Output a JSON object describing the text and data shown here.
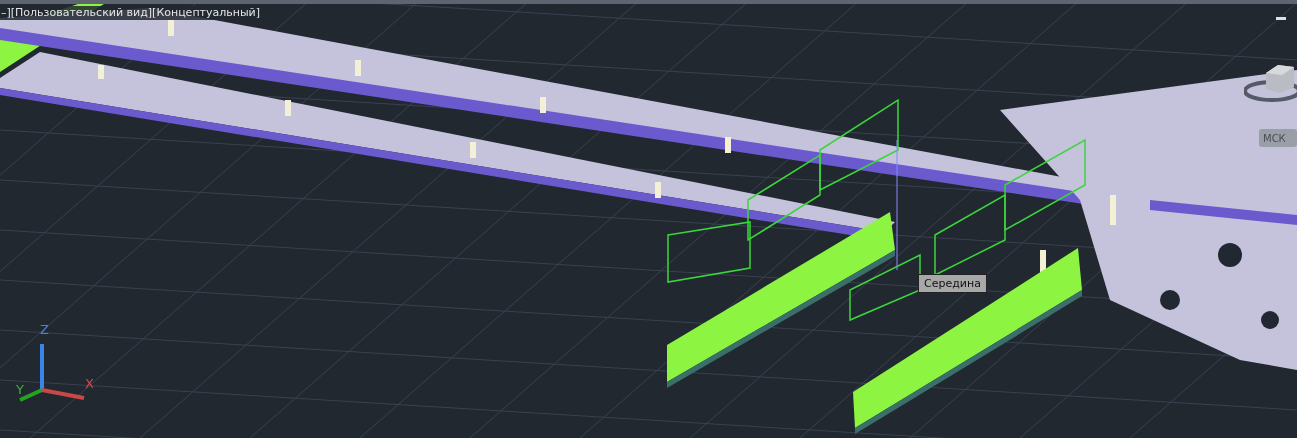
{
  "viewport": {
    "label": "–][Пользовательский вид][Концептуальный]"
  },
  "viewcube": {
    "ucs_button": "МСК"
  },
  "tooltip": {
    "text": "Середина"
  },
  "ucs_icon": {
    "x_label": "X",
    "y_label": "Y",
    "z_label": "Z"
  }
}
